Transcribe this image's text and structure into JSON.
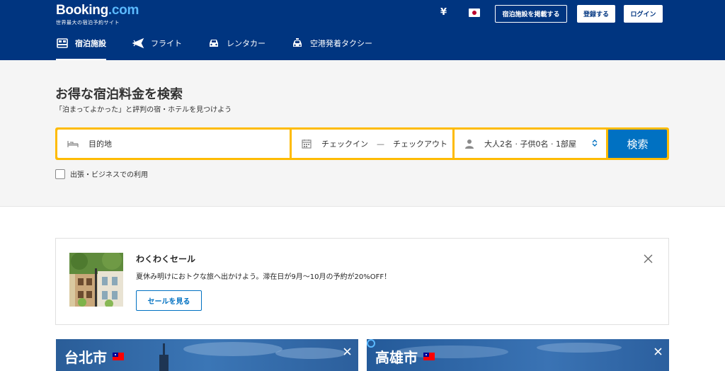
{
  "header": {
    "logo_name": "Booking",
    "logo_dot": ".com",
    "logo_tagline": "世界最大の宿泊予約サイト",
    "currency": "¥",
    "list_property_label": "宿泊施設を掲載する",
    "register_label": "登録する",
    "login_label": "ログイン"
  },
  "nav": {
    "items": [
      {
        "label": "宿泊施設",
        "icon": "bed-icon",
        "active": true
      },
      {
        "label": "フライト",
        "icon": "plane-icon",
        "active": false
      },
      {
        "label": "レンタカー",
        "icon": "car-icon",
        "active": false
      },
      {
        "label": "空港発着タクシー",
        "icon": "taxi-icon",
        "active": false
      }
    ]
  },
  "hero": {
    "title": "お得な宿泊料金を検索",
    "subtitle": "「泊まってよかった」と評判の宿・ホテルを見つけよう"
  },
  "search": {
    "destination_placeholder": "目的地",
    "checkin_label": "チェックイン",
    "dash": "—",
    "checkout_label": "チェックアウト",
    "guests_label": "大人2名 · 子供0名 · 1部屋",
    "submit_label": "検索",
    "business_trip_label": "出張・ビジネスでの利用"
  },
  "promo": {
    "title": "わくわくセール",
    "text": "夏休み明けにおトクな旅へ出かけよう。滞在日が9月～10月の予約が20%OFF！",
    "button_label": "セールを見る"
  },
  "cards": [
    {
      "city": "台北市"
    },
    {
      "city": "高雄市"
    }
  ],
  "colors": {
    "brand_blue": "#003580",
    "accent_yellow": "#febb02",
    "action_blue": "#0071c2"
  }
}
